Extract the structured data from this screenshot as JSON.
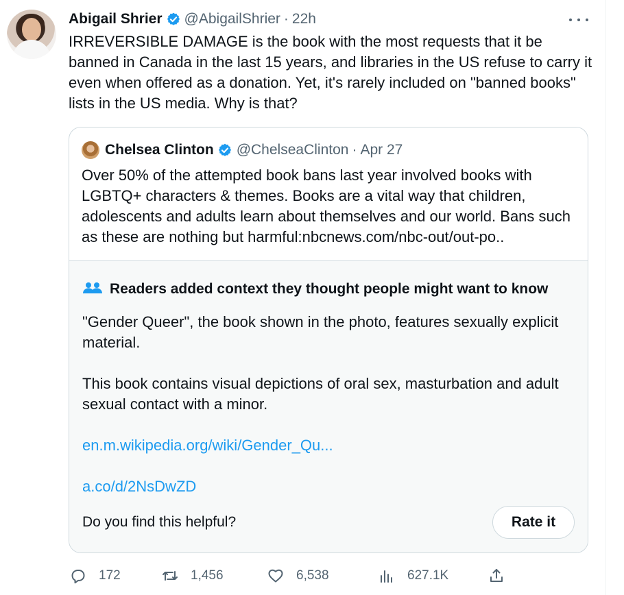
{
  "tweet": {
    "author_name": "Abigail Shrier",
    "handle": "@AbigailShrier",
    "separator": "·",
    "time": "22h",
    "text": "IRREVERSIBLE DAMAGE is the book with the most requests that it be banned in Canada in the last 15 years, and libraries in the US refuse to carry it even when offered as a donation. Yet, it's rarely included on \"banned books\" lists in the US media. Why is that?"
  },
  "quote": {
    "author_name": "Chelsea Clinton",
    "handle": "@ChelseaClinton",
    "separator": "·",
    "time": "Apr 27",
    "text": "Over 50% of the attempted book bans last year involved books with LGBTQ+ characters & themes. Books are a vital way that children, adolescents and adults learn about themselves and our world. Bans such as these are nothing but harmful:nbcnews.com/nbc-out/out-po.."
  },
  "community_note": {
    "title": "Readers added context they thought people might want to know",
    "paragraph1": "\"Gender Queer\", the book shown in the photo, features sexually explicit material.",
    "paragraph2": "This book contains visual depictions of oral sex, masturbation and adult sexual contact with a minor.",
    "link1": "en.m.wikipedia.org/wiki/Gender_Qu...",
    "link2": "a.co/d/2NsDwZD",
    "helpful_prompt": "Do you find this helpful?",
    "rate_label": "Rate it"
  },
  "actions": {
    "replies": "172",
    "reposts": "1,456",
    "likes": "6,538",
    "views": "627.1K"
  },
  "colors": {
    "verified_blue": "#1d9bf0",
    "link_blue": "#1d9bf0",
    "secondary_text": "#536471",
    "border": "#cfd9de",
    "note_background": "#f7f9f9"
  },
  "icons": {
    "verified": "verified-badge-icon",
    "more": "more-icon",
    "community": "people-icon",
    "reply": "reply-icon",
    "repost": "repost-icon",
    "like": "heart-icon",
    "views": "analytics-icon",
    "share": "share-icon"
  }
}
